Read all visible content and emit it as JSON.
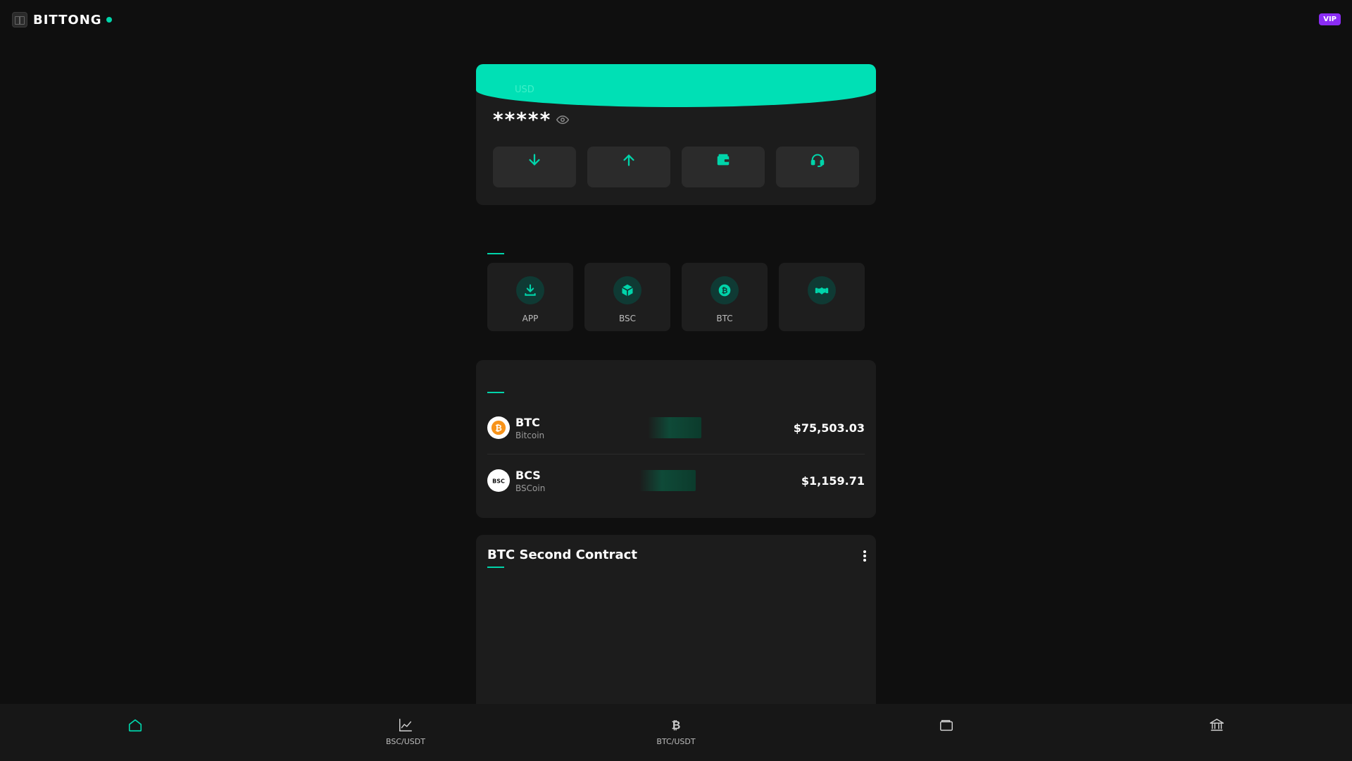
{
  "header": {
    "brand": "BITTONG",
    "vip_badge": "VIP"
  },
  "balance": {
    "currency": "USD",
    "masked_amount": "*****",
    "actions": [
      {
        "icon": "arrow-down-icon"
      },
      {
        "icon": "arrow-up-icon"
      },
      {
        "icon": "wallet-icon"
      },
      {
        "icon": "headset-icon"
      }
    ]
  },
  "quick_links": [
    {
      "label": "APP",
      "icon": "download-icon"
    },
    {
      "label": "BSC",
      "icon": "cube-icon"
    },
    {
      "label": "BTC",
      "icon": "bitcoin-icon"
    },
    {
      "label": "",
      "icon": "handshake-icon"
    }
  ],
  "market": {
    "coins": [
      {
        "symbol": "BTC",
        "name": "Bitcoin",
        "price": "$75,503.03",
        "icon": "bitcoin-icon"
      },
      {
        "symbol": "BCS",
        "name": "BSCoin",
        "price": "$1,159.71",
        "icon": "bsc-logo-icon",
        "icon_text": "BSC"
      }
    ]
  },
  "contract": {
    "title": "BTC Second Contract"
  },
  "nav": [
    {
      "label": "",
      "icon": "home-icon"
    },
    {
      "label": "BSC/USDT",
      "icon": "chart-line-icon"
    },
    {
      "label": "BTC/USDT",
      "icon": "bitcoin-icon"
    },
    {
      "label": "",
      "icon": "wallet-icon"
    },
    {
      "label": "",
      "icon": "bank-icon"
    }
  ],
  "colors": {
    "accent": "#00d4aa",
    "vip": "#8b2cf5",
    "background": "#0f0f0f",
    "card": "#1c1c1c",
    "bitcoin": "#f7931a"
  }
}
